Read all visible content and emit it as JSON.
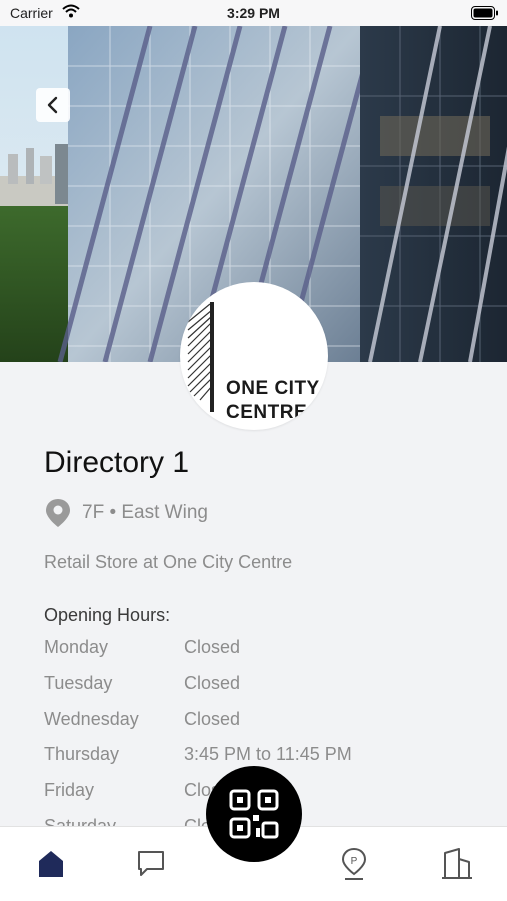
{
  "status_bar": {
    "carrier": "Carrier",
    "time": "3:29 PM"
  },
  "hero": {
    "image": "glass-skyscraper-facade-photo"
  },
  "logo": {
    "line1": "ONE CITY",
    "line2": "CENTRE"
  },
  "title": "Directory 1",
  "location": {
    "text": "7F • East Wing"
  },
  "description": "Retail Store at One City Centre",
  "opening_hours": {
    "heading": "Opening Hours:",
    "rows": [
      {
        "day": "Monday",
        "hours": "Closed"
      },
      {
        "day": "Tuesday",
        "hours": "Closed"
      },
      {
        "day": "Wednesday",
        "hours": "Closed"
      },
      {
        "day": "Thursday",
        "hours": "3:45 PM to 11:45 PM"
      },
      {
        "day": "Friday",
        "hours": "Closed"
      },
      {
        "day": "Saturday",
        "hours": "Closed"
      }
    ]
  },
  "tab_bar": {
    "tabs": [
      {
        "icon": "home-icon",
        "active": true
      },
      {
        "icon": "chat-icon",
        "active": false
      },
      {
        "icon": "parking-icon",
        "active": false
      },
      {
        "icon": "building-icon",
        "active": false
      }
    ],
    "center_button_icon": "qr-code-icon"
  },
  "colors": {
    "accent": "#1f2a5a",
    "background": "#f2f3f5",
    "muted_text": "#8c8c8c"
  }
}
